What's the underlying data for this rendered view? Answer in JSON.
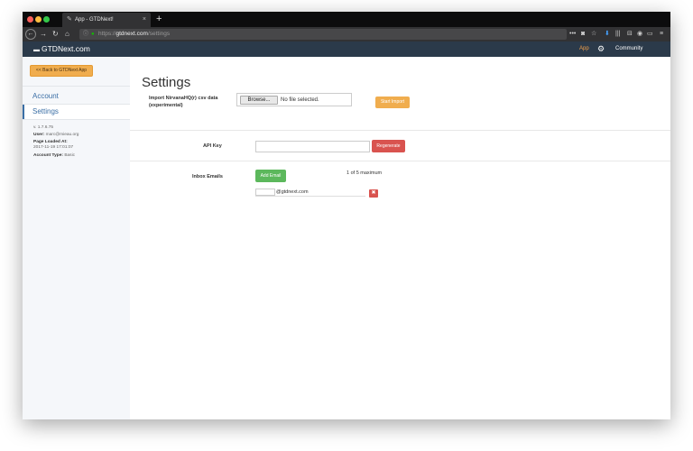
{
  "browser": {
    "tab_title": "App - GTDNext!",
    "tab_close": "×",
    "new_tab": "+",
    "url_info_icon": "ⓘ",
    "url_lock_icon": "🔒",
    "url_scheme": "https://",
    "url_host": "gtdnext.com",
    "url_path": "/settings",
    "icons": [
      "overflow-menu-icon",
      "pocket-icon",
      "bookmark-star-icon",
      "downloads-icon",
      "library-icon",
      "extension-icon",
      "sync-icon",
      "hamburger-menu-icon"
    ]
  },
  "app": {
    "brand": "GTDNext.com",
    "nav_app": "App",
    "nav_community": "Community",
    "accent_color": "#f0ad4e",
    "header_color": "#2b3a4a"
  },
  "sidebar": {
    "back_button": "<< Back to GTDNext App",
    "items": [
      {
        "label": "Account",
        "active": false
      },
      {
        "label": "Settings",
        "active": true
      }
    ],
    "version": "v. 1.7.6.75",
    "user_label": "User:",
    "user_value": "marc@mieau.org",
    "page_loaded_label": "Page Loaded At:",
    "page_loaded_value": "2017-11-19 17:01:07",
    "account_type_label": "Account Type:",
    "account_type_value": "Basic"
  },
  "main": {
    "title": "Settings",
    "import": {
      "label": "Import NirvanaHQ(r) csv data (experimental)",
      "browse_label": "Browse...",
      "file_status": "No file selected.",
      "start_button": "Start Import"
    },
    "api": {
      "label": "API Key",
      "value": "",
      "regenerate_button": "Regenerate"
    },
    "inbox": {
      "label": "Inbox Emails",
      "add_button": "Add Email",
      "max_note": "1 of 5 maximum",
      "emails": [
        {
          "prefix": "",
          "suffix": "@gtdnext.com",
          "delete_label": "✖"
        }
      ]
    }
  }
}
